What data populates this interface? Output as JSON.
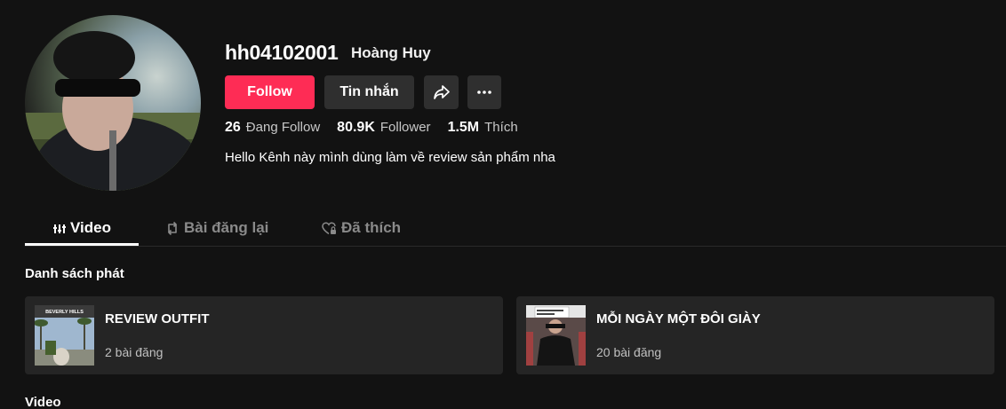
{
  "profile": {
    "username": "hh04102001",
    "nickname": "Hoàng Huy",
    "bio": "Hello Kênh này mình dùng làm về review sản phẩm nha"
  },
  "actions": {
    "follow_label": "Follow",
    "message_label": "Tin nhắn",
    "share_icon": "share-icon",
    "more_icon": "more-icon"
  },
  "stats": {
    "following_count": "26",
    "following_label": "Đang Follow",
    "followers_count": "80.9K",
    "followers_label": "Follower",
    "likes_count": "1.5M",
    "likes_label": "Thích"
  },
  "tabs": [
    {
      "label": "Video",
      "icon": "grid-icon",
      "active": true
    },
    {
      "label": "Bài đăng lại",
      "icon": "repost-icon",
      "active": false
    },
    {
      "label": "Đã thích",
      "icon": "heart-locked-icon",
      "active": false
    }
  ],
  "playlists": {
    "section_title": "Danh sách phát",
    "items": [
      {
        "title": "REVIEW OUTFIT",
        "count": "2 bài đăng",
        "thumb_text": "BEVERLY HILLS"
      },
      {
        "title": "MỖI NGÀY MỘT ĐÔI GIÀY",
        "count": "20 bài đăng"
      }
    ]
  },
  "videos": {
    "section_title": "Video"
  },
  "colors": {
    "background": "#121212",
    "accent": "#fe2c55",
    "button_secondary": "#2f2f2f",
    "card": "#252525"
  }
}
